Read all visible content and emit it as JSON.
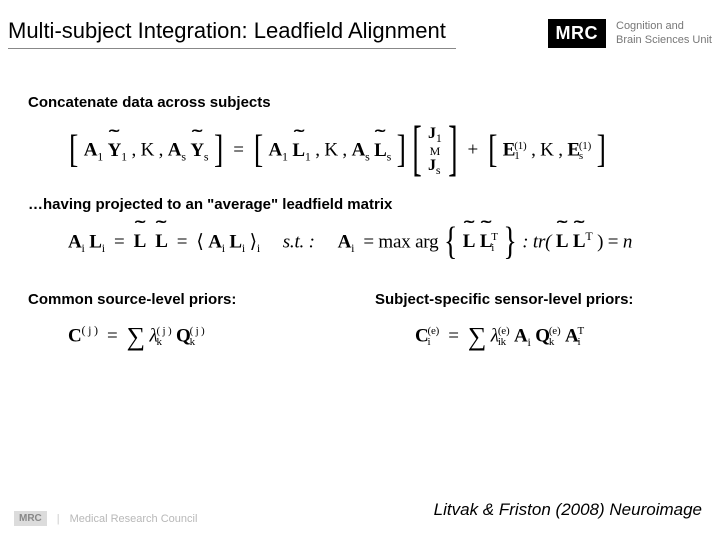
{
  "header": {
    "title": "Multi-subject Integration: Leadfield Alignment",
    "logo_mark": "MRC",
    "logo_line1": "Cognition and",
    "logo_line2": "Brain Sciences Unit"
  },
  "sections": {
    "s1_label": "Concatenate data across subjects",
    "s2_label": "…having projected to an \"average\" leadfield matrix",
    "col1_label": "Common source-level priors:",
    "col2_label": "Subject-specific sensor-level priors:"
  },
  "equations": {
    "eq1_lhs_a": "[",
    "eq1_A1": "A",
    "eq1_A1_sub": "1",
    "eq1_Y1": "Y",
    "eq1_Y1_sub": "1",
    "eq1_sep1": ", K ,",
    "eq1_As": "A",
    "eq1_As_sub": "s",
    "eq1_Ys": "Y",
    "eq1_Ys_sub": "s",
    "eq1_rhs_a": "]",
    "eq1_equals": "=",
    "eq1_L1": "L",
    "eq1_L1_sub": "1",
    "eq1_Ls": "L",
    "eq1_Ls_sub": "s",
    "eq1_J1": "J",
    "eq1_J1_sub": "1",
    "eq1_Js": "J",
    "eq1_Js_sub": "s",
    "eq1_M": "M",
    "eq1_plus": "+",
    "eq1_E1": "E",
    "eq1_E1_sub": "1",
    "eq1_E1_sup": "(1)",
    "eq1_Es": "E",
    "eq1_Es_sub": "s",
    "eq1_Es_sup": "(1)",
    "eq2_lhs_A": "A",
    "eq2_lhs_A_sub": "i",
    "eq2_lhs_L": "L",
    "eq2_lhs_L_sub": "i",
    "eq2_eq": "=",
    "eq2_L0": "L",
    "eq2_angle_l": "⟨",
    "eq2_AL": "A",
    "eq2_AL_sub": "i",
    "eq2_L": "L",
    "eq2_L_sub": "i",
    "eq2_angle_r": "⟩",
    "eq2_angle_sub": "i",
    "eq2_st": "s.t. :",
    "eq2_Ai": "A",
    "eq2_Ai_sub": "i",
    "eq2_maxarg": "= max arg",
    "eq2_LL": "L",
    "eq2_LLi": "L",
    "eq2_LLi_sub": "i",
    "eq2_LLi_sup": "T",
    "eq2_tr": ": tr(",
    "eq2_trL": "L",
    "eq2_trL2": "L",
    "eq2_trL2_sup": "T",
    "eq2_trend": ") = ",
    "eq2_n": "n",
    "eq3_C": "C",
    "eq3_C_sup": "( j )",
    "eq3_eq": "=",
    "eq3_sum": "∑",
    "eq3_lambda": "λ",
    "eq3_lambda_sub": "k",
    "eq3_lambda_sup": "( j )",
    "eq3_Q": "Q",
    "eq3_Q_sub": "k",
    "eq3_Q_sup": "( j )",
    "eq4_C": "C",
    "eq4_C_sub": "i",
    "eq4_C_sup": "(e)",
    "eq4_eq": "=",
    "eq4_sum": "∑",
    "eq4_lambda": "λ",
    "eq4_lambda_sub": "ik",
    "eq4_lambda_sup": "(e)",
    "eq4_A1": "A",
    "eq4_A1_sub": "i",
    "eq4_Q": "Q",
    "eq4_Q_sub": "k",
    "eq4_Q_sup": "(e)",
    "eq4_A2": "A",
    "eq4_A2_sub": "i",
    "eq4_A2_sup": "T"
  },
  "footer": {
    "logo": "MRC",
    "council": "Medical Research Council",
    "citation": "Litvak & Friston (2008) Neuroimage"
  }
}
